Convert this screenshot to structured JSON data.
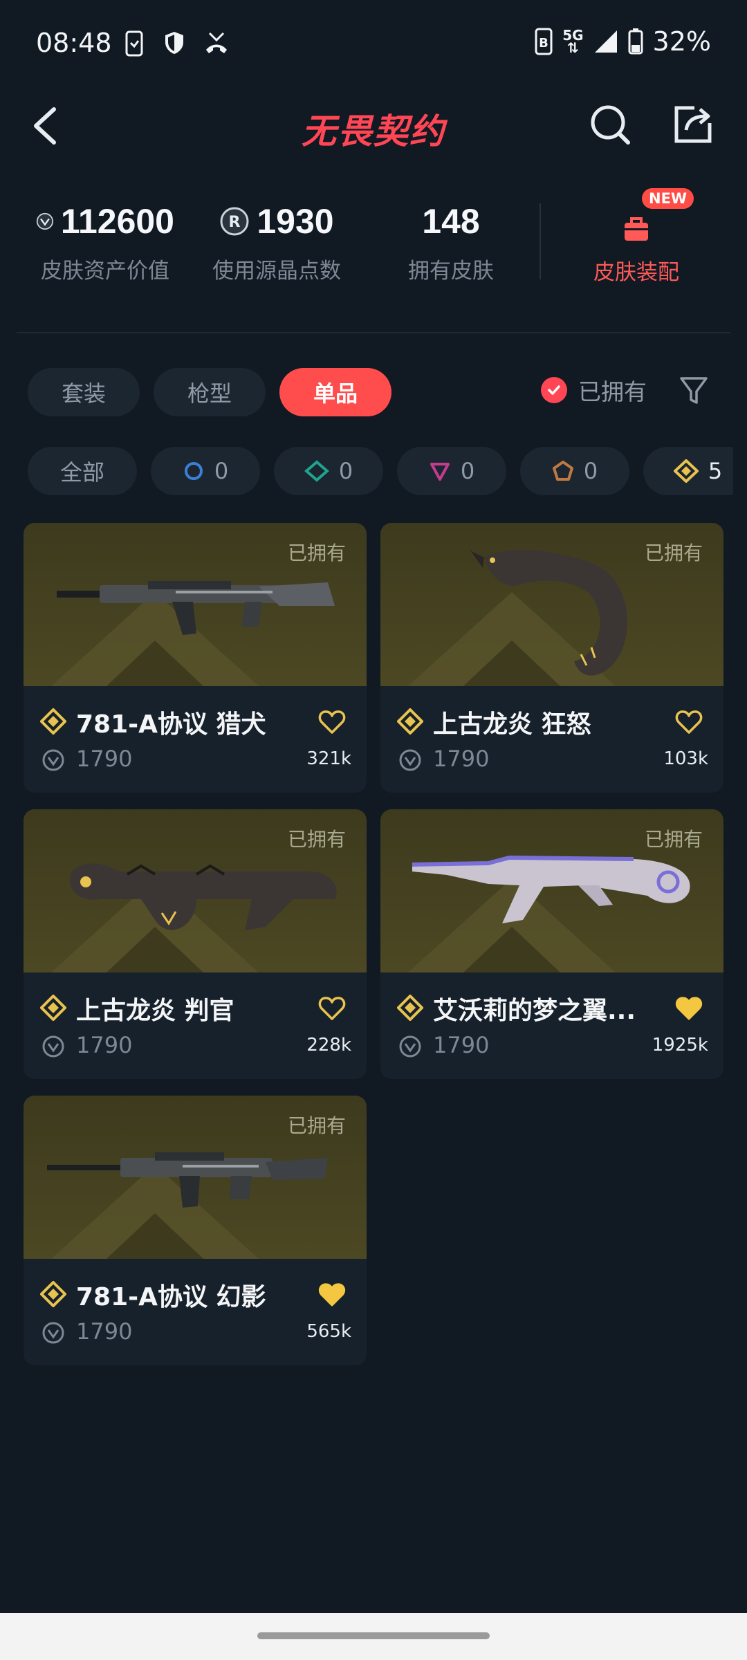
{
  "status_bar": {
    "time": "08:48",
    "network": "5G",
    "battery": "32%"
  },
  "header": {
    "title": "无畏契约",
    "icons": [
      "back-icon",
      "search-icon",
      "share-icon"
    ]
  },
  "stats": [
    {
      "value": "112600",
      "label": "皮肤资产价值",
      "icon": "vp-coin-icon"
    },
    {
      "value": "1930",
      "label": "使用源晶点数",
      "icon": "radianite-icon"
    },
    {
      "value": "148",
      "label": "拥有皮肤",
      "icon": ""
    }
  ],
  "equip": {
    "label": "皮肤装配",
    "badge": "NEW",
    "icon": "bag-icon"
  },
  "tabs": [
    {
      "label": "套装",
      "active": false
    },
    {
      "label": "枪型",
      "active": false
    },
    {
      "label": "单品",
      "active": true
    }
  ],
  "owned_filter": {
    "label": "已拥有",
    "checked": true
  },
  "chips": [
    {
      "label": "全部",
      "count": ""
    },
    {
      "label": "",
      "count": "0",
      "color": "#3c7fd6",
      "shape": "circle"
    },
    {
      "label": "",
      "count": "0",
      "color": "#1fa58f",
      "shape": "diamond"
    },
    {
      "label": "",
      "count": "0",
      "color": "#c43c8e",
      "shape": "triangle"
    },
    {
      "label": "",
      "count": "0",
      "color": "#c07a40",
      "shape": "pentagon"
    },
    {
      "label": "",
      "count": "5",
      "color": "#e9c34f",
      "shape": "diamond-gold"
    }
  ],
  "cards": [
    {
      "name": "781-A协议 猎犬",
      "owned": "已拥有",
      "price": "1790",
      "likes": "321k",
      "liked": false
    },
    {
      "name": "上古龙炎 狂怒",
      "owned": "已拥有",
      "price": "1790",
      "likes": "103k",
      "liked": false
    },
    {
      "name": "上古龙炎 判官",
      "owned": "已拥有",
      "price": "1790",
      "likes": "228k",
      "liked": false
    },
    {
      "name": "艾沃莉的梦之翼...",
      "owned": "已拥有",
      "price": "1790",
      "likes": "1925k",
      "liked": true
    },
    {
      "name": "781-A协议 幻影",
      "owned": "已拥有",
      "price": "1790",
      "likes": "565k",
      "liked": true
    }
  ],
  "colors": {
    "accent": "#ff4655",
    "background": "#111923",
    "gold": "#e9c34f"
  }
}
